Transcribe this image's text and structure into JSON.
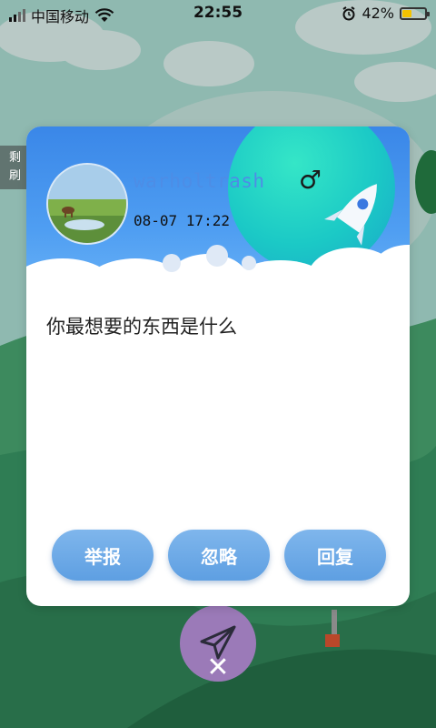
{
  "status_bar": {
    "carrier": "中国移动",
    "time": "22:55",
    "battery_percent": "42%",
    "battery_level": 0.42,
    "icons": [
      "signal-icon",
      "wifi-icon",
      "alarm-icon",
      "battery-icon"
    ]
  },
  "side_strip": {
    "line1": "剩",
    "line2": "刷"
  },
  "card": {
    "username": "warholtrash",
    "gender_symbol": "♂",
    "timestamp": "08-07 17:22",
    "question": "你最想要的东西是什么",
    "buttons": {
      "report": "举报",
      "ignore": "忽略",
      "reply": "回复"
    }
  },
  "fab": {
    "icon": "paper-plane-icon",
    "close_symbol": "✕"
  },
  "colors": {
    "button": "#6aa8e7",
    "header_blue": "#3f8fea",
    "planet": "#1fcfc6",
    "fab": "#9b7ab8",
    "battery": "#f2c200"
  }
}
